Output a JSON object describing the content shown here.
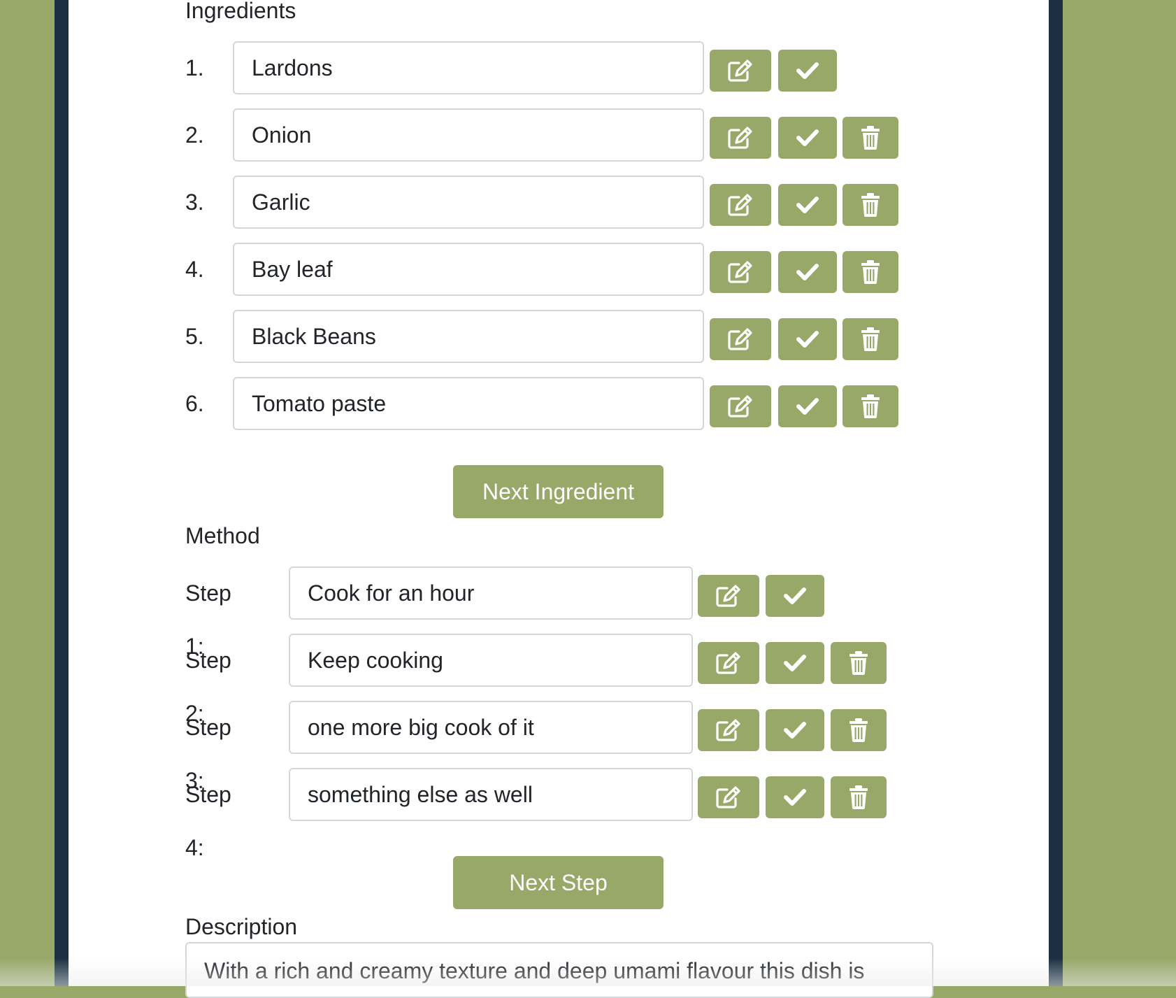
{
  "ingredients": {
    "label": "Ingredients",
    "items": [
      {
        "number": "1.",
        "value": "Lardons",
        "deletable": false
      },
      {
        "number": "2.",
        "value": "Onion",
        "deletable": true
      },
      {
        "number": "3.",
        "value": "Garlic",
        "deletable": true
      },
      {
        "number": "4.",
        "value": "Bay leaf",
        "deletable": true
      },
      {
        "number": "5.",
        "value": "Black Beans",
        "deletable": true
      },
      {
        "number": "6.",
        "value": "Tomato paste",
        "deletable": true
      }
    ],
    "next_button": "Next Ingredient"
  },
  "method": {
    "label": "Method",
    "steps": [
      {
        "number": "Step 1:",
        "value": "Cook for an hour",
        "deletable": false
      },
      {
        "number": "Step 2:",
        "value": "Keep cooking",
        "deletable": true
      },
      {
        "number": "Step 3:",
        "value": "one more big cook of it",
        "deletable": true
      },
      {
        "number": "Step 4:",
        "value": "something else as well",
        "deletable": true
      }
    ],
    "next_button": "Next Step"
  },
  "description": {
    "label": "Description",
    "value": "With a rich and creamy texture and deep umami flavour this dish is"
  },
  "icons": {
    "edit": "edit-icon",
    "confirm": "checkmark-icon",
    "delete": "trash-icon"
  },
  "colors": {
    "background": "#97a869",
    "frame": "#1b3143",
    "button": "#97a869",
    "panel": "#ffffff"
  }
}
